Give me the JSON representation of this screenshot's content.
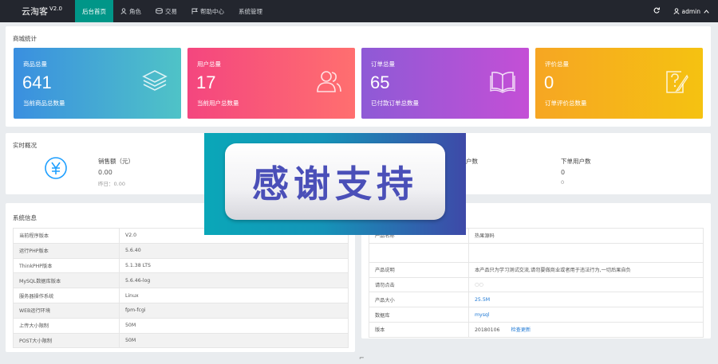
{
  "app": {
    "name": "云淘客",
    "version": "V2.0"
  },
  "nav": [
    {
      "label": "后台首页",
      "icon": "none",
      "active": true
    },
    {
      "label": "角色",
      "icon": "user-icon",
      "active": false
    },
    {
      "label": "交易",
      "icon": "database-icon",
      "active": false
    },
    {
      "label": "帮助中心",
      "icon": "flag-icon",
      "active": false
    },
    {
      "label": "系统管理",
      "icon": "none",
      "active": false
    }
  ],
  "header": {
    "refresh_icon": "refresh-icon",
    "username": "admin"
  },
  "stats_panel": {
    "title": "商城统计",
    "cards": [
      {
        "label": "商品总量",
        "value": "641",
        "sub": "当前商品总数量",
        "icon": "layers-icon",
        "color": "#3a8fe0"
      },
      {
        "label": "用户总量",
        "value": "17",
        "sub": "当前用户总数量",
        "icon": "users-icon",
        "color": "#f4467f"
      },
      {
        "label": "订单总量",
        "value": "65",
        "sub": "已付款订单总数量",
        "icon": "book-icon",
        "color": "#8e5ad6"
      },
      {
        "label": "评价总量",
        "value": "0",
        "sub": "订单评价总数量",
        "icon": "help-edit-icon",
        "color": "#f6a623"
      }
    ]
  },
  "realtime": {
    "title": "实时概况",
    "sales_label": "销售额（元）",
    "sales_value": "0.00",
    "sales_prev": "昨日：0.00",
    "col3_label_partial": "户数",
    "order_users_label": "下单用户数",
    "order_users_value": "0",
    "order_users_prev": "0"
  },
  "system_info": {
    "title": "系统信息",
    "rows": [
      [
        "当前程序版本",
        "V2.0"
      ],
      [
        "运行PHP版本",
        "5.6.40"
      ],
      [
        "ThinkPHP版本",
        "5.1.38 LTS"
      ],
      [
        "MySQL数据库版本",
        "5.6.46-log"
      ],
      [
        "服务器操作系统",
        "Linux"
      ],
      [
        "WEB运行环境",
        "fpm-fcgi"
      ],
      [
        "上传大小限制",
        "50M"
      ],
      [
        "POST大小限制",
        "50M"
      ]
    ]
  },
  "product_info": {
    "rows": [
      [
        "产品名称",
        "热果源码"
      ],
      [
        "",
        ""
      ],
      [
        "产品说明",
        "本产品只为学习测试交流,请勿要做商业或者用于违法行为,一切后果自负"
      ],
      [
        "请勿点击",
        "○○"
      ],
      [
        "产品大小",
        "25.5M"
      ],
      [
        "数据库",
        "mysql"
      ],
      [
        "版本",
        "20180106"
      ]
    ],
    "check_update": "检查更新"
  },
  "banner": {
    "text": "感谢支持"
  }
}
